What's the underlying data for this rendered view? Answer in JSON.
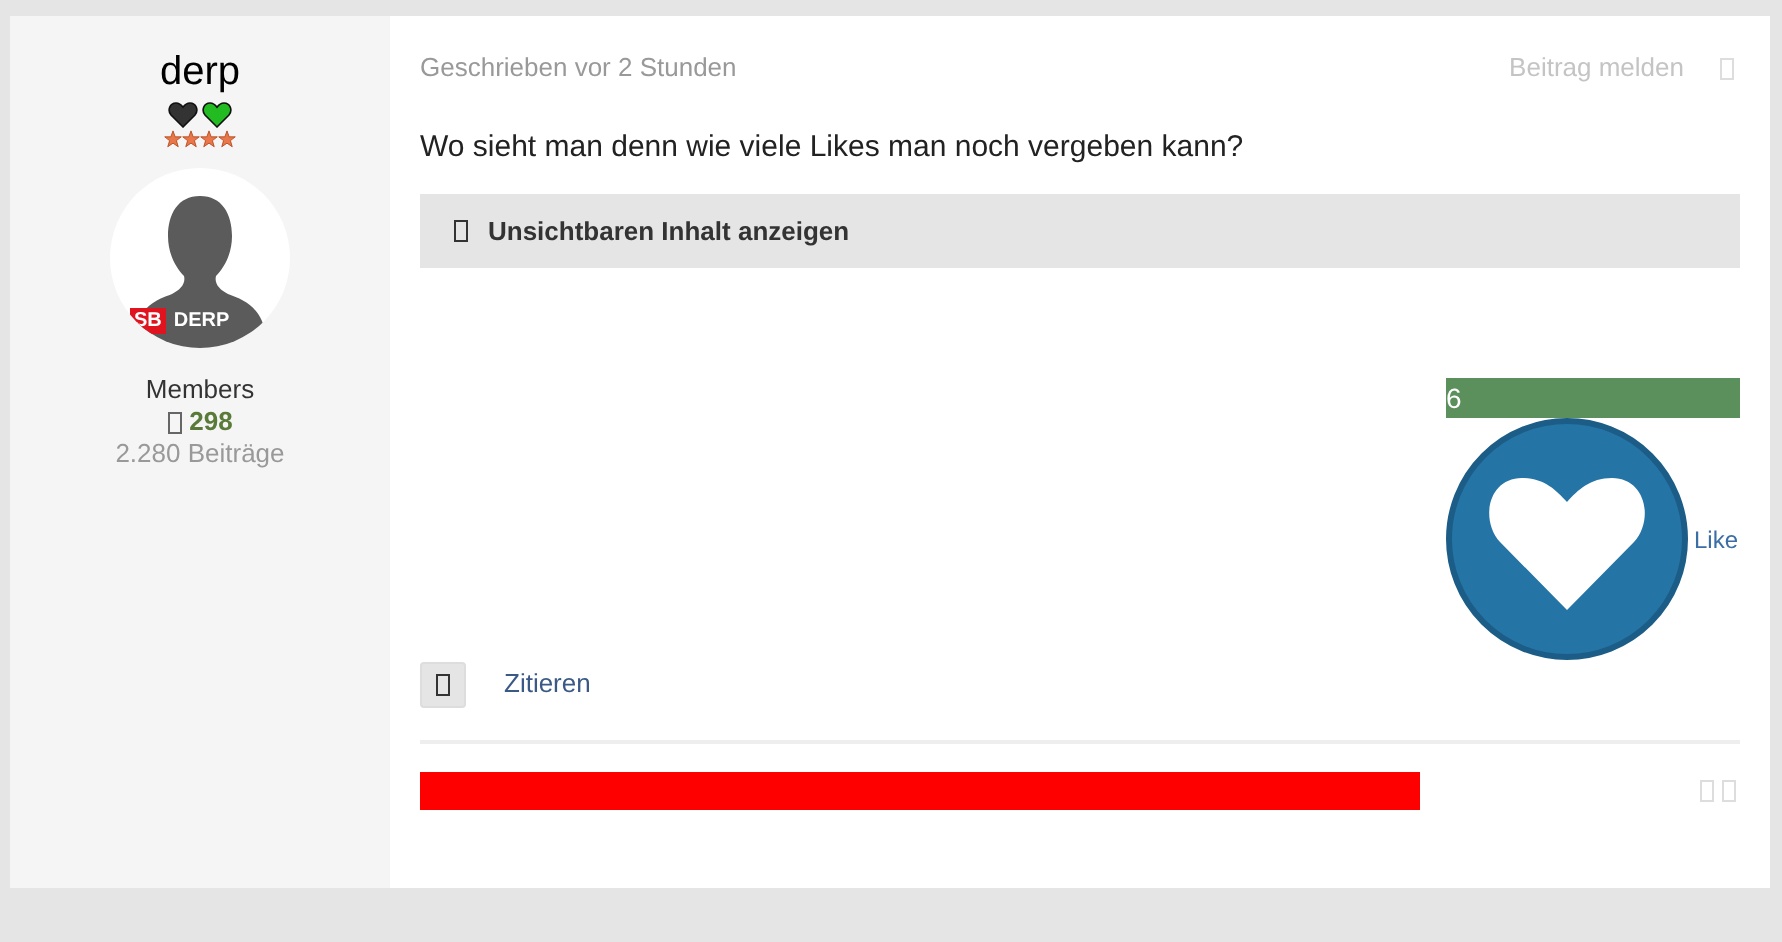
{
  "author": {
    "name": "derp",
    "hearts": [
      {
        "color": "#333333"
      },
      {
        "color": "#22bb22"
      }
    ],
    "stars": 4,
    "avatar_badge": {
      "tag": "SB",
      "label": "DERP"
    },
    "group": "Members",
    "reputation": "298",
    "posts": "2.280 Beiträge"
  },
  "post": {
    "meta": "Geschrieben vor 2 Stunden",
    "report": "Beitrag melden",
    "text": "Wo sieht man denn wie viele Likes man noch vergeben kann?",
    "spoiler": "Unsichtbaren Inhalt anzeigen",
    "likes": {
      "count": "6",
      "label": "Like"
    },
    "quote": "Zitieren"
  }
}
